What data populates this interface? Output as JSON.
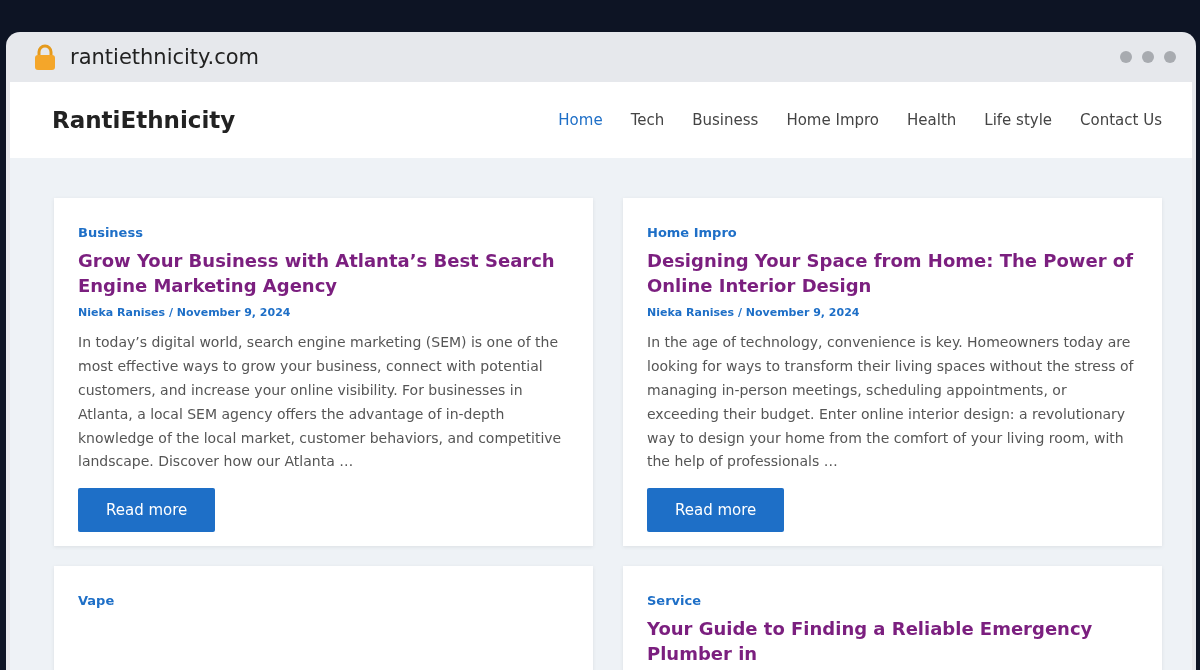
{
  "browser": {
    "address": "rantiethnicity.com"
  },
  "site": {
    "logo": "RantiEthnicity"
  },
  "nav": [
    {
      "label": "Home",
      "selected": true
    },
    {
      "label": "Tech",
      "selected": false
    },
    {
      "label": "Business",
      "selected": false
    },
    {
      "label": "Home Impro",
      "selected": false
    },
    {
      "label": "Health",
      "selected": false
    },
    {
      "label": "Life style",
      "selected": false
    },
    {
      "label": "Contact Us",
      "selected": false
    }
  ],
  "posts": [
    {
      "category": "Business",
      "title": "Grow Your Business with Atlanta’s Best Search Engine Marketing Agency",
      "meta": "Nieka Ranises / November 9, 2024",
      "excerpt": "In today’s digital world, search engine marketing (SEM) is one of the most effective ways to grow your business, connect with potential customers, and increase your online visibility. For businesses in Atlanta, a local SEM agency offers the advantage of in-depth knowledge of the local market, customer behaviors, and competitive landscape. Discover how our Atlanta …",
      "button": "Read more"
    },
    {
      "category": "Home Impro",
      "title": "Designing Your Space from Home: The Power of Online Interior Design",
      "meta": "Nieka Ranises / November 9, 2024",
      "excerpt": "In the age of technology, convenience is key. Homeowners today are looking for ways to transform their living spaces without the stress of managing in-person meetings, scheduling appointments, or exceeding their budget. Enter online interior design: a revolutionary way to design your home from the comfort of your living room, with the help of professionals …",
      "button": "Read more"
    },
    {
      "category": "Vape"
    },
    {
      "category": "Service",
      "title": "Your Guide to Finding a Reliable Emergency Plumber in"
    }
  ]
}
